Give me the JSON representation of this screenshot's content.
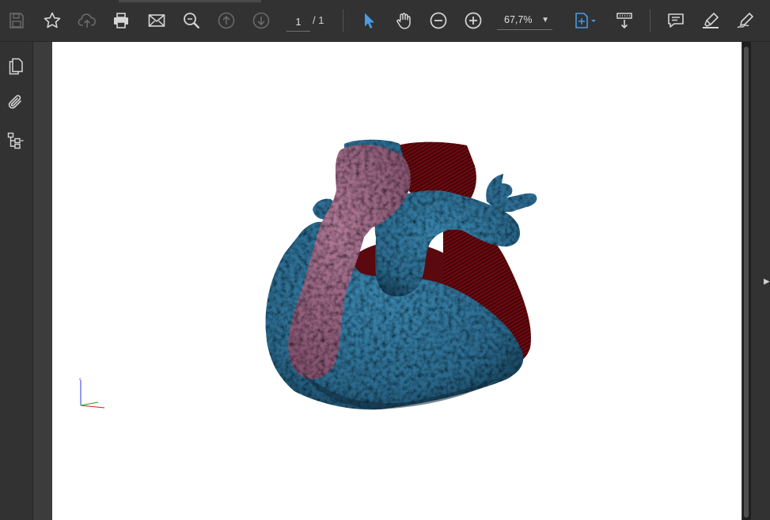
{
  "toolbar": {
    "buttons": [
      {
        "name": "save-button",
        "icon": "save-icon"
      },
      {
        "name": "bookmark-button",
        "icon": "star-icon"
      },
      {
        "name": "upload-button",
        "icon": "cloud-upload-icon"
      },
      {
        "name": "print-button",
        "icon": "print-icon"
      },
      {
        "name": "email-button",
        "icon": "mail-icon"
      },
      {
        "name": "find-button",
        "icon": "search-icon"
      },
      {
        "name": "previous-page-button",
        "icon": "arrow-up-circle-icon"
      },
      {
        "name": "next-page-button",
        "icon": "arrow-down-circle-icon"
      },
      {
        "name": "select-tool-button",
        "icon": "cursor-icon"
      },
      {
        "name": "hand-tool-button",
        "icon": "hand-icon"
      },
      {
        "name": "zoom-out-button",
        "icon": "minus-circle-icon"
      },
      {
        "name": "zoom-in-button",
        "icon": "plus-circle-icon"
      },
      {
        "name": "fit-page-button",
        "icon": "fit-page-icon"
      },
      {
        "name": "scroll-mode-button",
        "icon": "scroll-mode-icon"
      },
      {
        "name": "comment-button",
        "icon": "comment-icon"
      },
      {
        "name": "highlight-button",
        "icon": "highlighter-icon"
      },
      {
        "name": "sign-button",
        "icon": "sign-pen-icon"
      }
    ],
    "page_current": "1",
    "page_total": "/ 1",
    "zoom": "67,7%"
  },
  "leftrail": {
    "items": [
      {
        "name": "page-thumbnails-button",
        "icon": "pages-icon"
      },
      {
        "name": "attachments-button",
        "icon": "paperclip-icon"
      },
      {
        "name": "bookmarks-tree-button",
        "icon": "tree-icon"
      }
    ]
  },
  "colors": {
    "toolbar_bg": "#323232",
    "accent": "#4a9be8",
    "model_blue": "#2e6d92",
    "model_red": "#7a0c12",
    "model_pink": "#9a6080"
  }
}
